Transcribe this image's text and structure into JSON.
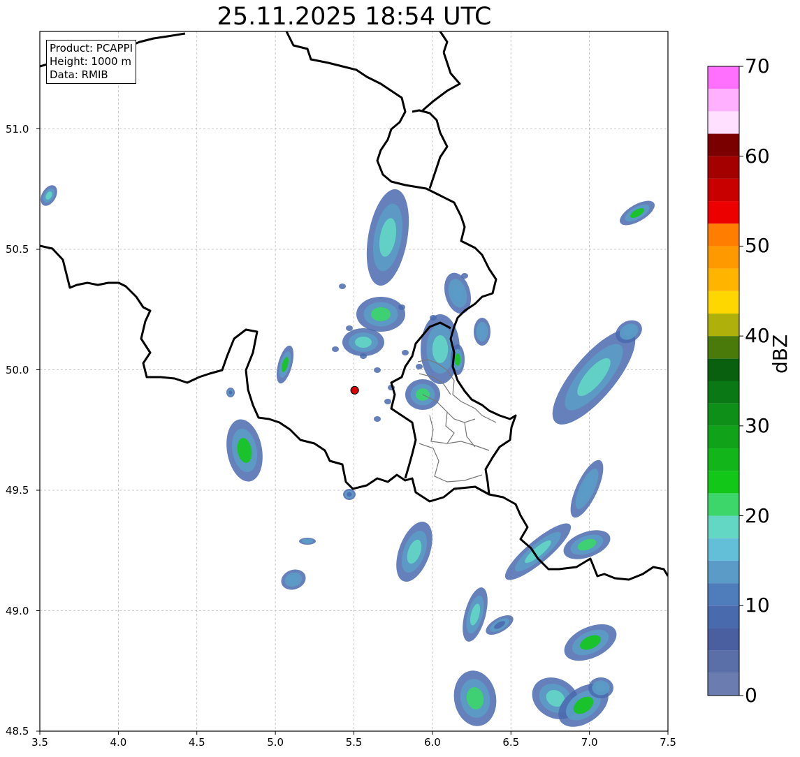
{
  "title": "25.11.2025 18:54 UTC",
  "info": {
    "product": "Product: PCAPPI",
    "height": "Height: 1000 m",
    "data": "Data: RMIB"
  },
  "axes": {
    "xticks": [
      "3.5",
      "4.0",
      "4.5",
      "5.0",
      "5.5",
      "6.0",
      "6.5",
      "7.0",
      "7.5"
    ],
    "yticks": [
      "51.0",
      "50.5",
      "50.0",
      "49.5",
      "49.0",
      "48.5"
    ],
    "xlim": [
      3.5,
      7.5
    ],
    "ylim": [
      48.5,
      51.4
    ]
  },
  "colorbar": {
    "label": "dBZ",
    "ticks": [
      "0",
      "10",
      "20",
      "30",
      "40",
      "50",
      "60",
      "70"
    ],
    "colors": [
      "#6b7db0",
      "#5a6ea8",
      "#4a5fa0",
      "#4a6aae",
      "#4f7dbb",
      "#5b9bc7",
      "#63bfd8",
      "#63d6c4",
      "#3dd66a",
      "#13c719",
      "#12b51a",
      "#10a31a",
      "#0d8f18",
      "#0a7814",
      "#09600f",
      "#4a7a0a",
      "#b0b00a",
      "#ffd700",
      "#ffb400",
      "#ff9900",
      "#ff7d00",
      "#ec0000",
      "#c80000",
      "#a40000",
      "#7a0000",
      "#ffe0ff",
      "#ffb0ff",
      "#ff70ff",
      "#ee33ee"
    ]
  },
  "radar_site": {
    "lon": 5.505,
    "lat": 49.915
  }
}
